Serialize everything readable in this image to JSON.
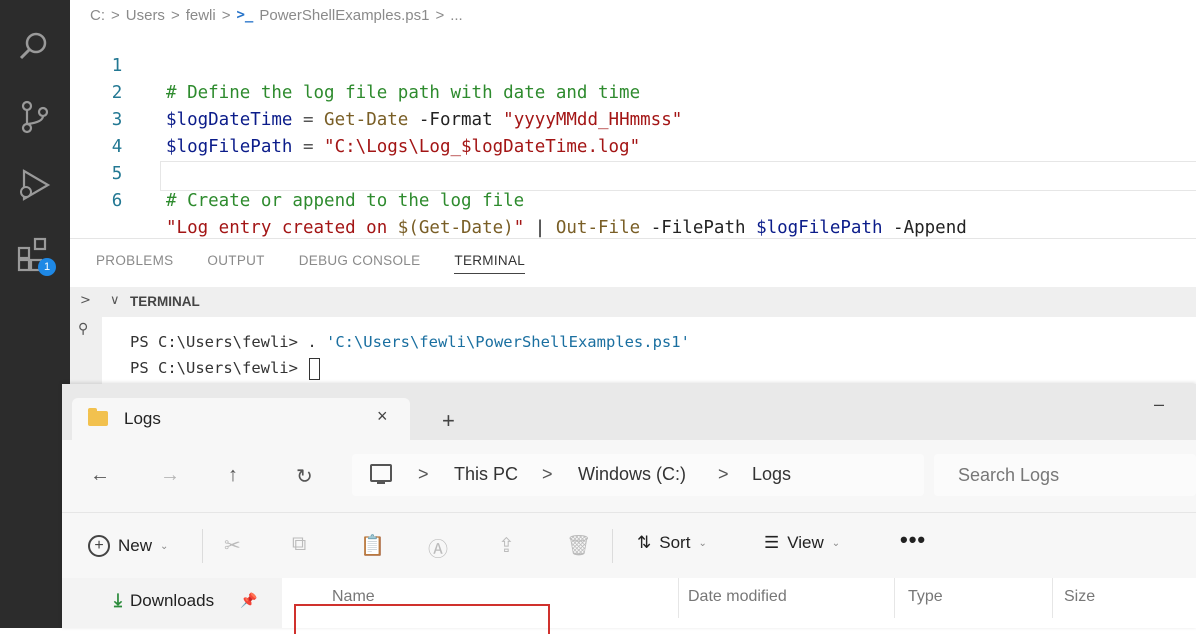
{
  "activity_bar": {
    "icons": [
      "search-icon",
      "source-control-icon",
      "run-debug-icon",
      "extensions-icon"
    ],
    "extensions_badge": "1"
  },
  "editor": {
    "breadcrumb": [
      "C:",
      "Users",
      "fewli",
      "PowerShellExamples.ps1"
    ],
    "breadcrumb_sep": ">",
    "line_numbers": [
      "1",
      "2",
      "3",
      "4",
      "5",
      "6"
    ],
    "lines": {
      "l1": "# Define the log file path with date and time",
      "l2_var": "$logDateTime",
      "l2_op": " = ",
      "l2_cmd": "Get-Date",
      "l2_param": " -Format ",
      "l2_str": "\"yyyyMMdd_HHmmss\"",
      "l3_var": "$logFilePath",
      "l3_op": " = ",
      "l3_str": "\"C:\\Logs\\Log_$logDateTime.log\"",
      "l5": "# Create or append to the log file",
      "l6_str_a": "\"Log entry created on ",
      "l6_sub": "$(Get-Date)",
      "l6_str_b": "\"",
      "l6_pipe": " | ",
      "l6_cmd": "Out-File",
      "l6_param1": " -FilePath ",
      "l6_var": "$logFilePath",
      "l6_param2": " -Append"
    }
  },
  "panel": {
    "tabs": [
      "PROBLEMS",
      "OUTPUT",
      "DEBUG CONSOLE",
      "TERMINAL"
    ],
    "terminal_title": "TERMINAL",
    "terminal_lines": {
      "line1_prompt": "PS C:\\Users\\fewli> ",
      "line1_cmd": ". ",
      "line1_path": "'C:\\Users\\fewli\\PowerShellExamples.ps1'",
      "line2_prompt": "PS C:\\Users\\fewli> "
    }
  },
  "explorer": {
    "tab_title": "Logs",
    "tab_close": "×",
    "tab_add": "+",
    "minimize": "–",
    "nav": {
      "back": "←",
      "forward": "→",
      "up": "↑",
      "refresh": "↻"
    },
    "address": [
      "This PC",
      "Windows (C:)",
      "Logs"
    ],
    "address_sep": ">",
    "search_placeholder": "Search Logs",
    "commands": {
      "new": "New",
      "sort": "Sort",
      "view": "View",
      "more": "•••"
    },
    "nav_pane": {
      "downloads": "Downloads"
    },
    "columns": [
      "Name",
      "Date modified",
      "Type",
      "Size"
    ]
  },
  "colors": {
    "activity_bg": "#2c2c2c",
    "highlight_box": "#d0312d",
    "folder": "#f2c14e"
  }
}
